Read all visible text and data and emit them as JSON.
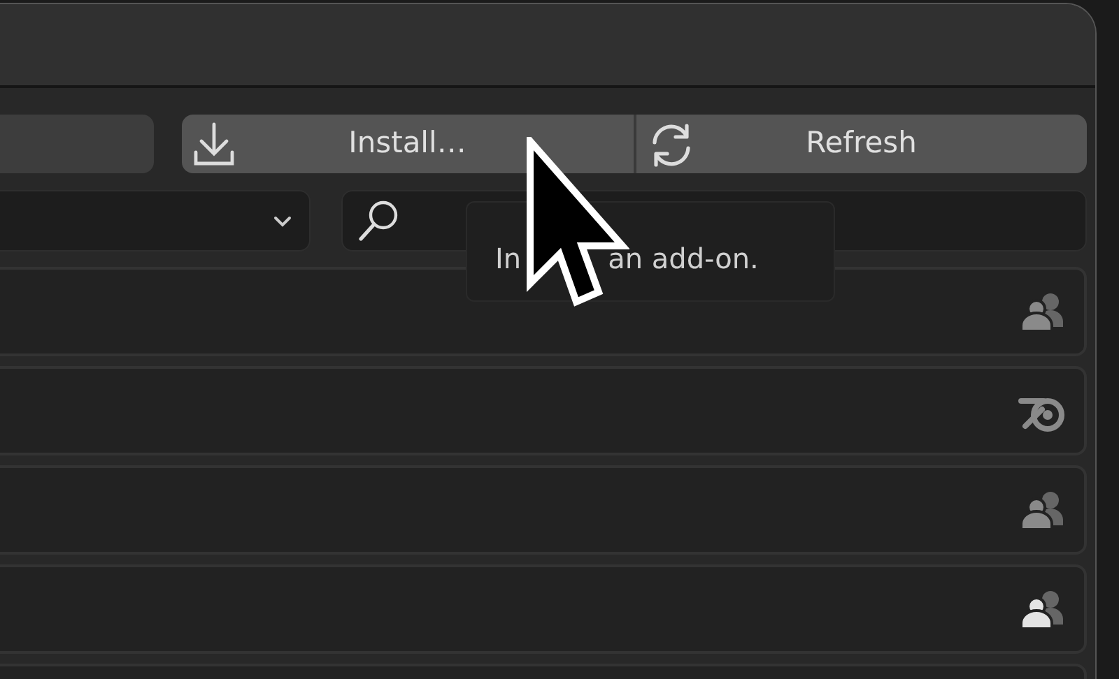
{
  "toolbar": {
    "buttons": [
      {
        "label": "Install…",
        "kind": "download"
      },
      {
        "label": "Refresh",
        "kind": "refresh"
      }
    ]
  },
  "tooltip": {
    "parts": [
      "In",
      "an add-on."
    ]
  },
  "addons": [
    {
      "kind": "community",
      "highlighted": false
    },
    {
      "kind": "official",
      "highlighted": false
    },
    {
      "kind": "community",
      "highlighted": false
    },
    {
      "kind": "community",
      "highlighted": true
    }
  ]
}
